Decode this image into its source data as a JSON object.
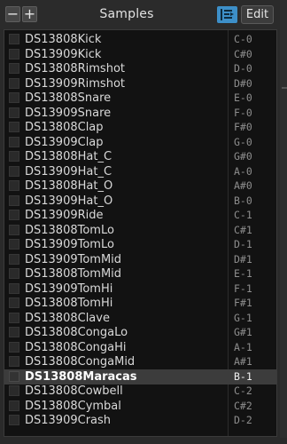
{
  "header": {
    "remove_label": "−",
    "add_label": "+",
    "title": "Samples",
    "sequencer_icon": "sequencer-view-icon",
    "edit_label": "Edit",
    "accent": "#3d8fc8"
  },
  "samples": [
    {
      "name": "DS13808Kick",
      "note": "C-0"
    },
    {
      "name": "DS13909Kick",
      "note": "C#0"
    },
    {
      "name": "DS13808Rimshot",
      "note": "D-0"
    },
    {
      "name": "DS13909Rimshot",
      "note": "D#0"
    },
    {
      "name": "DS13808Snare",
      "note": "E-0"
    },
    {
      "name": "DS13909Snare",
      "note": "F-0"
    },
    {
      "name": "DS13808Clap",
      "note": "F#0"
    },
    {
      "name": "DS13909Clap",
      "note": "G-0"
    },
    {
      "name": "DS13808Hat_C",
      "note": "G#0"
    },
    {
      "name": "DS13909Hat_C",
      "note": "A-0"
    },
    {
      "name": "DS13808Hat_O",
      "note": "A#0"
    },
    {
      "name": "DS13909Hat_O",
      "note": "B-0"
    },
    {
      "name": "DS13909Ride",
      "note": "C-1"
    },
    {
      "name": "DS13808TomLo",
      "note": "C#1"
    },
    {
      "name": "DS13909TomLo",
      "note": "D-1"
    },
    {
      "name": "DS13909TomMid",
      "note": "D#1"
    },
    {
      "name": "DS13808TomMid",
      "note": "E-1"
    },
    {
      "name": "DS13909TomHi",
      "note": "F-1"
    },
    {
      "name": "DS13808TomHi",
      "note": "F#1"
    },
    {
      "name": "DS13808Clave",
      "note": "G-1"
    },
    {
      "name": "DS13808CongaLo",
      "note": "G#1"
    },
    {
      "name": "DS13808CongaHi",
      "note": "A-1"
    },
    {
      "name": "DS13808CongaMid",
      "note": "A#1"
    },
    {
      "name": "DS13808Maracas",
      "note": "B-1",
      "selected": true
    },
    {
      "name": "DS13808Cowbell",
      "note": "C-2"
    },
    {
      "name": "DS13808Cymbal",
      "note": "C#2"
    },
    {
      "name": "DS13909Crash",
      "note": "D-2"
    }
  ]
}
